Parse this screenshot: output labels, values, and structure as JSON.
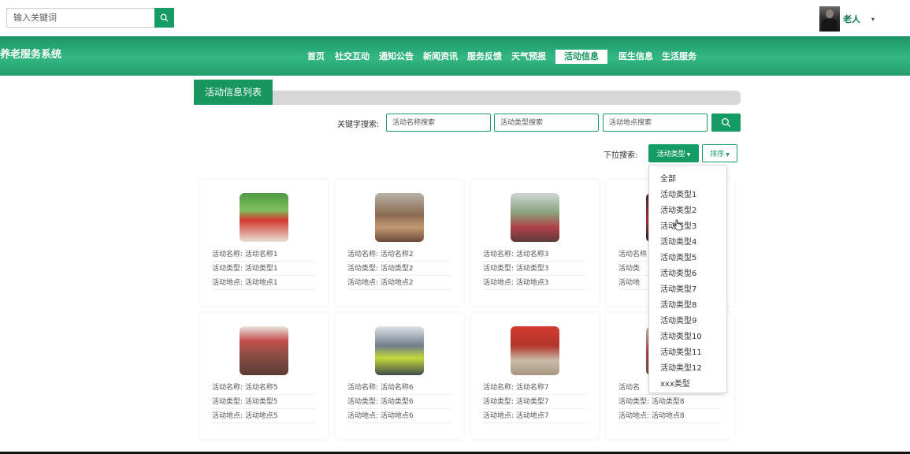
{
  "top": {
    "search_placeholder": "输入关键词",
    "user_name": "老人",
    "user_caret": "▾"
  },
  "nav": {
    "brand": "养老服务系统",
    "items": [
      "首页",
      "社交互动",
      "通知公告",
      "新闻资讯",
      "服务反馈",
      "天气预报",
      "活动信息",
      "医生信息",
      "生活服务"
    ],
    "active_item": "活动信息"
  },
  "list": {
    "title": "活动信息列表",
    "keyword_label": "关键字搜索:",
    "name_placeholder": "活动名称搜索",
    "type_placeholder": "活动类型搜索",
    "location_placeholder": "活动地点搜索",
    "dropdown_label": "下拉搜索:",
    "type_button": "活动类型",
    "sort_button": "排序",
    "dropdown_options": [
      "全部",
      "活动类型1",
      "活动类型2",
      "活动类型3",
      "活动类型4",
      "活动类型5",
      "活动类型6",
      "活动类型7",
      "活动类型8",
      "活动类型9",
      "活动类型10",
      "活动类型11",
      "活动类型12",
      "xxx类型"
    ]
  },
  "cards": [
    {
      "name": "活动名称: 活动名称1",
      "type": "活动类型: 活动类型1",
      "location": "活动地点: 活动地点1"
    },
    {
      "name": "活动名称: 活动名称2",
      "type": "活动类型: 活动类型2",
      "location": "活动地点: 活动地点2"
    },
    {
      "name": "活动名称: 活动名称3",
      "type": "活动类型: 活动类型3",
      "location": "活动地点: 活动地点3"
    },
    {
      "name": "活动名称",
      "type": "活动类",
      "location": "活动地"
    },
    {
      "name": "活动名称: 活动名称5",
      "type": "活动类型: 活动类型5",
      "location": "活动地点: 活动地点5"
    },
    {
      "name": "活动名称: 活动名称6",
      "type": "活动类型: 活动类型6",
      "location": "活动地点: 活动地点6"
    },
    {
      "name": "活动名称: 活动名称7",
      "type": "活动类型: 活动类型7",
      "location": "活动地点: 活动地点7"
    },
    {
      "name": "活动名",
      "type": "活动类型: 活动类型8",
      "location": "活动地点: 活动地点8"
    }
  ],
  "colors": {
    "primary": "#159b64",
    "nav_gradient_light": "#33b883",
    "title_bar": "#17975f"
  },
  "icons": {
    "search": "search-icon",
    "caret": "caret-down-icon",
    "cursor": "mouse-pointer-icon"
  }
}
